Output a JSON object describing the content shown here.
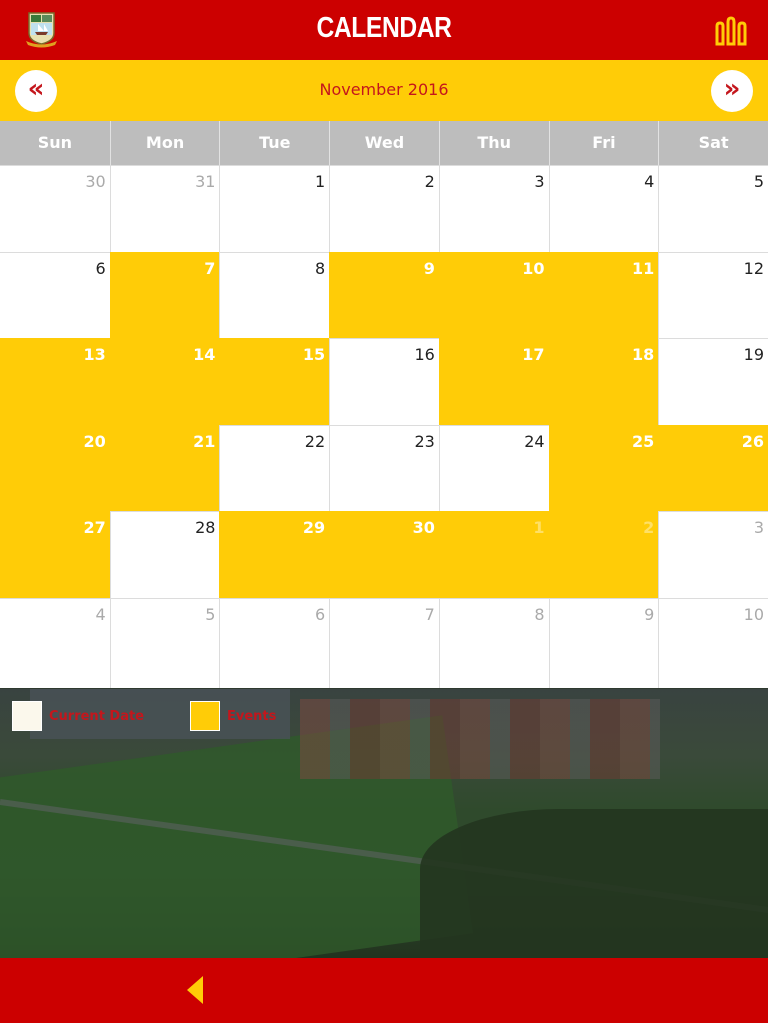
{
  "header": {
    "title": "CALENDAR",
    "crest_icon": "school-crest-logo",
    "home_icon": "building-columns-icon"
  },
  "month_nav": {
    "current_month": "November 2016",
    "prev_label": "«",
    "next_label": "»"
  },
  "calendar": {
    "weekdays": [
      "Sun",
      "Mon",
      "Tue",
      "Wed",
      "Thu",
      "Fri",
      "Sat"
    ],
    "days": [
      {
        "n": "30",
        "other": true,
        "event": false
      },
      {
        "n": "31",
        "other": true,
        "event": false
      },
      {
        "n": "1",
        "other": false,
        "event": false
      },
      {
        "n": "2",
        "other": false,
        "event": false
      },
      {
        "n": "3",
        "other": false,
        "event": false
      },
      {
        "n": "4",
        "other": false,
        "event": false
      },
      {
        "n": "5",
        "other": false,
        "event": false
      },
      {
        "n": "6",
        "other": false,
        "event": false
      },
      {
        "n": "7",
        "other": false,
        "event": true
      },
      {
        "n": "8",
        "other": false,
        "event": false
      },
      {
        "n": "9",
        "other": false,
        "event": true
      },
      {
        "n": "10",
        "other": false,
        "event": true
      },
      {
        "n": "11",
        "other": false,
        "event": true
      },
      {
        "n": "12",
        "other": false,
        "event": false
      },
      {
        "n": "13",
        "other": false,
        "event": true
      },
      {
        "n": "14",
        "other": false,
        "event": true
      },
      {
        "n": "15",
        "other": false,
        "event": true
      },
      {
        "n": "16",
        "other": false,
        "event": false
      },
      {
        "n": "17",
        "other": false,
        "event": true
      },
      {
        "n": "18",
        "other": false,
        "event": true
      },
      {
        "n": "19",
        "other": false,
        "event": false
      },
      {
        "n": "20",
        "other": false,
        "event": true
      },
      {
        "n": "21",
        "other": false,
        "event": true
      },
      {
        "n": "22",
        "other": false,
        "event": false
      },
      {
        "n": "23",
        "other": false,
        "event": false
      },
      {
        "n": "24",
        "other": false,
        "event": false
      },
      {
        "n": "25",
        "other": false,
        "event": true
      },
      {
        "n": "26",
        "other": false,
        "event": true
      },
      {
        "n": "27",
        "other": false,
        "event": true
      },
      {
        "n": "28",
        "other": false,
        "event": false
      },
      {
        "n": "29",
        "other": false,
        "event": true
      },
      {
        "n": "30",
        "other": false,
        "event": true
      },
      {
        "n": "1",
        "other": true,
        "event": true
      },
      {
        "n": "2",
        "other": true,
        "event": true
      },
      {
        "n": "3",
        "other": true,
        "event": false
      },
      {
        "n": "4",
        "other": true,
        "event": false
      },
      {
        "n": "5",
        "other": true,
        "event": false
      },
      {
        "n": "6",
        "other": true,
        "event": false
      },
      {
        "n": "7",
        "other": true,
        "event": false
      },
      {
        "n": "8",
        "other": true,
        "event": false
      },
      {
        "n": "9",
        "other": true,
        "event": false
      },
      {
        "n": "10",
        "other": true,
        "event": false
      }
    ]
  },
  "legend": {
    "current_date_label": "Current Date",
    "events_label": "Events",
    "current_date_color": "#fbf8ec",
    "events_color": "#ffcc07"
  },
  "colors": {
    "brand_red": "#cc0000",
    "accent_yellow": "#ffcc07",
    "text_red": "#c4161c"
  },
  "footer": {
    "back_icon": "back-arrow-icon"
  }
}
